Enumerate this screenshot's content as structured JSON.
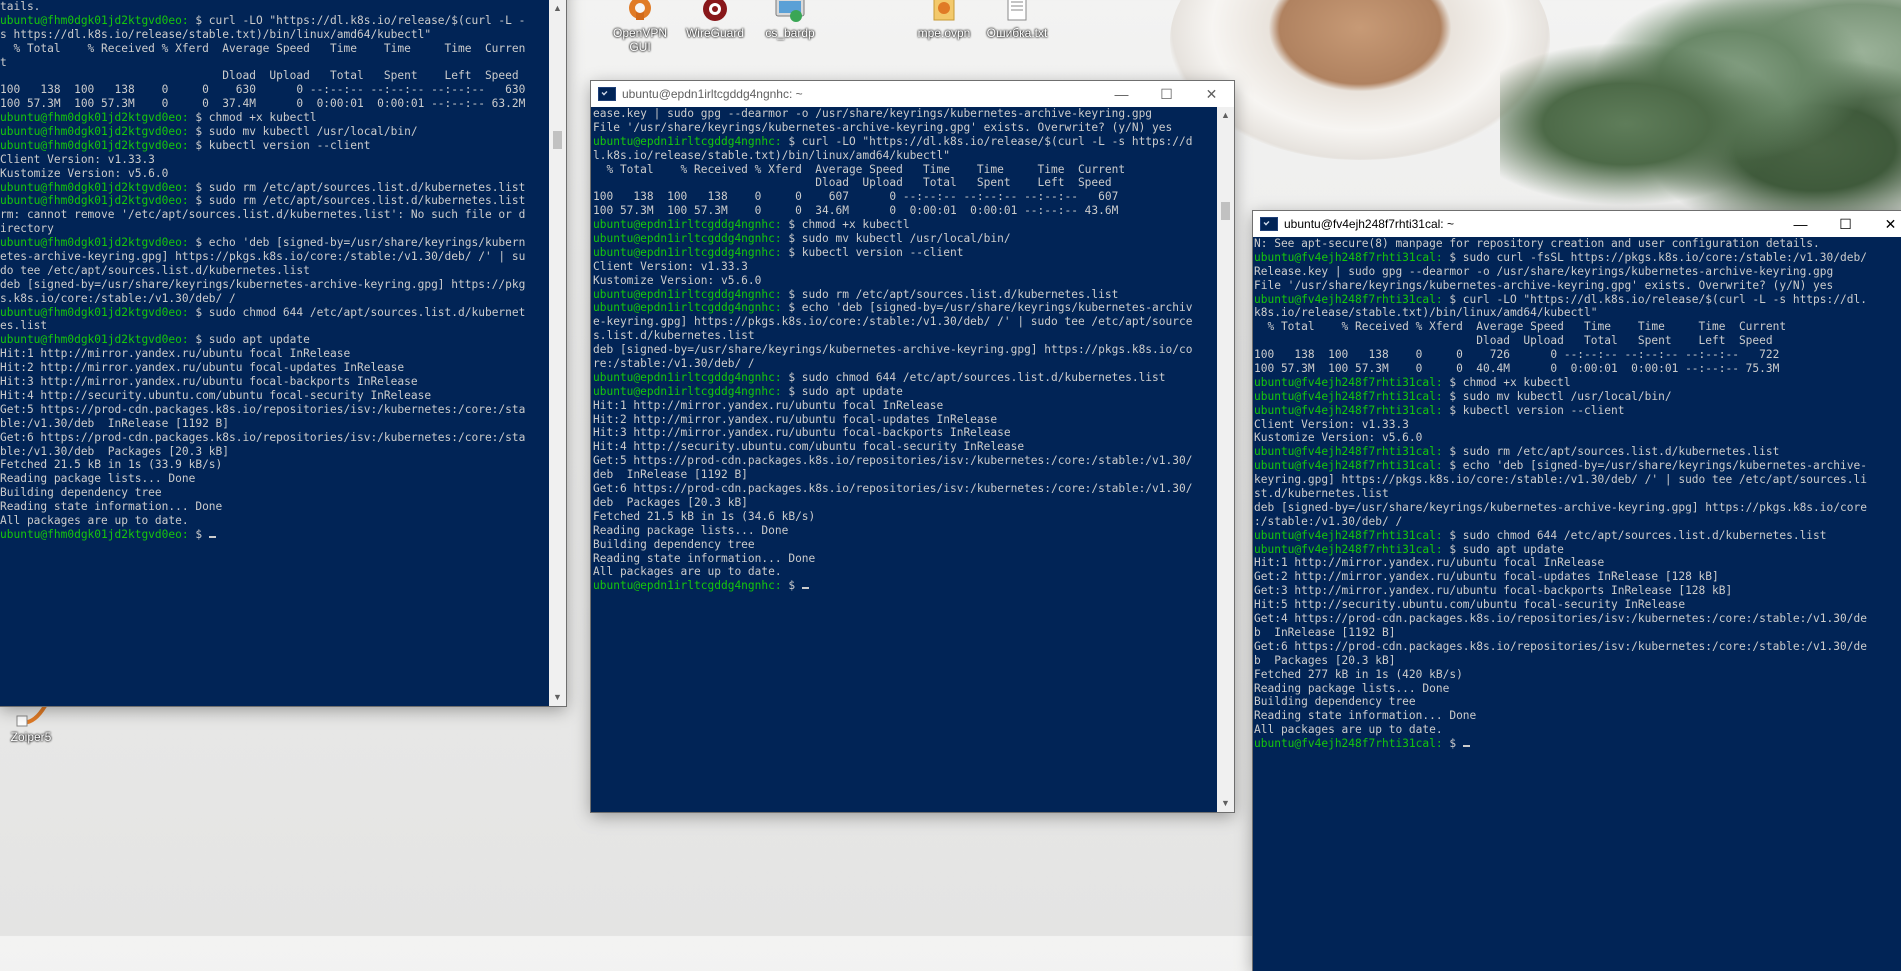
{
  "desktop": {
    "icons": [
      {
        "label": "OpenVPN GUI",
        "icon": "openvpn-icon"
      },
      {
        "label": "WireGuard",
        "icon": "wireguard-icon"
      },
      {
        "label": "cs_bardp",
        "icon": "rdp-icon"
      },
      {
        "label": "mpe.ovpn",
        "icon": "config-file-icon"
      },
      {
        "label": "Ошибка.txt",
        "icon": "text-file-icon"
      },
      {
        "label": "Zoiper5",
        "icon": "zoiper-icon"
      }
    ]
  },
  "windows": [
    {
      "id": "left",
      "title": "",
      "lines": [
        "tails.",
        [
          {
            "t": "ubuntu@fhm0dgk01jd2ktgvd0eo:",
            "c": "p"
          },
          {
            "t": " $ curl -LO \"https://dl.k8s.io/release/$(curl -L -"
          }
        ],
        "s https://dl.k8s.io/release/stable.txt)/bin/linux/amd64/kubectl\"",
        "  % Total    % Received % Xferd  Average Speed   Time    Time     Time  Curren",
        "t",
        "                                 Dload  Upload   Total   Spent    Left  Speed",
        "100   138  100   138    0     0    630      0 --:--:-- --:--:-- --:--:--   630",
        "100 57.3M  100 57.3M    0     0  37.4M      0  0:00:01  0:00:01 --:--:-- 63.2M",
        [
          {
            "t": "ubuntu@fhm0dgk01jd2ktgvd0eo:",
            "c": "p"
          },
          {
            "t": " $ chmod +x kubectl"
          }
        ],
        [
          {
            "t": "ubuntu@fhm0dgk01jd2ktgvd0eo:",
            "c": "p"
          },
          {
            "t": " $ sudo mv kubectl /usr/local/bin/"
          }
        ],
        [
          {
            "t": "ubuntu@fhm0dgk01jd2ktgvd0eo:",
            "c": "p"
          },
          {
            "t": " $ kubectl version --client"
          }
        ],
        "Client Version: v1.33.3",
        "Kustomize Version: v5.6.0",
        [
          {
            "t": "ubuntu@fhm0dgk01jd2ktgvd0eo:",
            "c": "p"
          },
          {
            "t": " $ sudo rm /etc/apt/sources.list.d/kubernetes.list"
          }
        ],
        [
          {
            "t": "ubuntu@fhm0dgk01jd2ktgvd0eo:",
            "c": "p"
          },
          {
            "t": " $ sudo rm /etc/apt/sources.list.d/kubernetes.list"
          }
        ],
        "rm: cannot remove '/etc/apt/sources.list.d/kubernetes.list': No such file or d",
        "irectory",
        [
          {
            "t": "ubuntu@fhm0dgk01jd2ktgvd0eo:",
            "c": "p"
          },
          {
            "t": " $ echo 'deb [signed-by=/usr/share/keyrings/kubern"
          }
        ],
        "etes-archive-keyring.gpg] https://pkgs.k8s.io/core:/stable:/v1.30/deb/ /' | su",
        "do tee /etc/apt/sources.list.d/kubernetes.list",
        "deb [signed-by=/usr/share/keyrings/kubernetes-archive-keyring.gpg] https://pkg",
        "s.k8s.io/core:/stable:/v1.30/deb/ /",
        [
          {
            "t": "ubuntu@fhm0dgk01jd2ktgvd0eo:",
            "c": "p"
          },
          {
            "t": " $ sudo chmod 644 /etc/apt/sources.list.d/kubernet"
          }
        ],
        "es.list",
        [
          {
            "t": "ubuntu@fhm0dgk01jd2ktgvd0eo:",
            "c": "p"
          },
          {
            "t": " $ sudo apt update"
          }
        ],
        "Hit:1 http://mirror.yandex.ru/ubuntu focal InRelease",
        "Hit:2 http://mirror.yandex.ru/ubuntu focal-updates InRelease",
        "Hit:3 http://mirror.yandex.ru/ubuntu focal-backports InRelease",
        "Hit:4 http://security.ubuntu.com/ubuntu focal-security InRelease",
        "Get:5 https://prod-cdn.packages.k8s.io/repositories/isv:/kubernetes:/core:/sta",
        "ble:/v1.30/deb  InRelease [1192 B]",
        "Get:6 https://prod-cdn.packages.k8s.io/repositories/isv:/kubernetes:/core:/sta",
        "ble:/v1.30/deb  Packages [20.3 kB]",
        "Fetched 21.5 kB in 1s (33.9 kB/s)",
        "Reading package lists... Done",
        "Building dependency tree",
        "Reading state information... Done",
        "All packages are up to date.",
        [
          {
            "t": "ubuntu@fhm0dgk01jd2ktgvd0eo:",
            "c": "p"
          },
          {
            "t": " $ "
          },
          {
            "cursor": true
          }
        ]
      ]
    },
    {
      "id": "middle",
      "title": "ubuntu@epdn1irltcgddg4ngnhc: ~",
      "lines": [
        "ease.key | sudo gpg --dearmor -o /usr/share/keyrings/kubernetes-archive-keyring.gpg",
        "File '/usr/share/keyrings/kubernetes-archive-keyring.gpg' exists. Overwrite? (y/N) yes",
        [
          {
            "t": "ubuntu@epdn1irltcgddg4ngnhc:",
            "c": "p"
          },
          {
            "t": " $ curl -LO \"https://dl.k8s.io/release/$(curl -L -s https://d"
          }
        ],
        "l.k8s.io/release/stable.txt)/bin/linux/amd64/kubectl\"",
        "  % Total    % Received % Xferd  Average Speed   Time    Time     Time  Current",
        "                                 Dload  Upload   Total   Spent    Left  Speed",
        "100   138  100   138    0     0    607      0 --:--:-- --:--:-- --:--:--   607",
        "100 57.3M  100 57.3M    0     0  34.6M      0  0:00:01  0:00:01 --:--:-- 43.6M",
        [
          {
            "t": "ubuntu@epdn1irltcgddg4ngnhc:",
            "c": "p"
          },
          {
            "t": " $ chmod +x kubectl"
          }
        ],
        [
          {
            "t": "ubuntu@epdn1irltcgddg4ngnhc:",
            "c": "p"
          },
          {
            "t": " $ sudo mv kubectl /usr/local/bin/"
          }
        ],
        [
          {
            "t": "ubuntu@epdn1irltcgddg4ngnhc:",
            "c": "p"
          },
          {
            "t": " $ kubectl version --client"
          }
        ],
        "Client Version: v1.33.3",
        "Kustomize Version: v5.6.0",
        [
          {
            "t": "ubuntu@epdn1irltcgddg4ngnhc:",
            "c": "p"
          },
          {
            "t": " $ sudo rm /etc/apt/sources.list.d/kubernetes.list"
          }
        ],
        [
          {
            "t": "ubuntu@epdn1irltcgddg4ngnhc:",
            "c": "p"
          },
          {
            "t": " $ echo 'deb [signed-by=/usr/share/keyrings/kubernetes-archiv"
          }
        ],
        "e-keyring.gpg] https://pkgs.k8s.io/core:/stable:/v1.30/deb/ /' | sudo tee /etc/apt/source",
        "s.list.d/kubernetes.list",
        "deb [signed-by=/usr/share/keyrings/kubernetes-archive-keyring.gpg] https://pkgs.k8s.io/co",
        "re:/stable:/v1.30/deb/ /",
        [
          {
            "t": "ubuntu@epdn1irltcgddg4ngnhc:",
            "c": "p"
          },
          {
            "t": " $ sudo chmod 644 /etc/apt/sources.list.d/kubernetes.list"
          }
        ],
        [
          {
            "t": "ubuntu@epdn1irltcgddg4ngnhc:",
            "c": "p"
          },
          {
            "t": " $ sudo apt update"
          }
        ],
        "Hit:1 http://mirror.yandex.ru/ubuntu focal InRelease",
        "Hit:2 http://mirror.yandex.ru/ubuntu focal-updates InRelease",
        "Hit:3 http://mirror.yandex.ru/ubuntu focal-backports InRelease",
        "Hit:4 http://security.ubuntu.com/ubuntu focal-security InRelease",
        "Get:5 https://prod-cdn.packages.k8s.io/repositories/isv:/kubernetes:/core:/stable:/v1.30/",
        "deb  InRelease [1192 B]",
        "Get:6 https://prod-cdn.packages.k8s.io/repositories/isv:/kubernetes:/core:/stable:/v1.30/",
        "deb  Packages [20.3 kB]",
        "Fetched 21.5 kB in 1s (34.6 kB/s)",
        "Reading package lists... Done",
        "Building dependency tree",
        "Reading state information... Done",
        "All packages are up to date.",
        [
          {
            "t": "ubuntu@epdn1irltcgddg4ngnhc:",
            "c": "p"
          },
          {
            "t": " $ "
          },
          {
            "cursor": true
          }
        ]
      ]
    },
    {
      "id": "right",
      "title": "ubuntu@fv4ejh248f7rhti31cal: ~",
      "lines": [
        "N: See apt-secure(8) manpage for repository creation and user configuration details.",
        [
          {
            "t": "ubuntu@fv4ejh248f7rhti31cal:",
            "c": "p"
          },
          {
            "t": " $ sudo curl -fsSL https://pkgs.k8s.io/core:/stable:/v1.30/deb/"
          }
        ],
        "Release.key | sudo gpg --dearmor -o /usr/share/keyrings/kubernetes-archive-keyring.gpg",
        "File '/usr/share/keyrings/kubernetes-archive-keyring.gpg' exists. Overwrite? (y/N) yes",
        [
          {
            "t": "ubuntu@fv4ejh248f7rhti31cal:",
            "c": "p"
          },
          {
            "t": " $ curl -LO \"https://dl.k8s.io/release/$(curl -L -s https://dl."
          }
        ],
        "k8s.io/release/stable.txt)/bin/linux/amd64/kubectl\"",
        "  % Total    % Received % Xferd  Average Speed   Time    Time     Time  Current",
        "                                 Dload  Upload   Total   Spent    Left  Speed",
        "100   138  100   138    0     0    726      0 --:--:-- --:--:-- --:--:--   722",
        "100 57.3M  100 57.3M    0     0  40.4M      0  0:00:01  0:00:01 --:--:-- 75.3M",
        [
          {
            "t": "ubuntu@fv4ejh248f7rhti31cal:",
            "c": "p"
          },
          {
            "t": " $ chmod +x kubectl"
          }
        ],
        [
          {
            "t": "ubuntu@fv4ejh248f7rhti31cal:",
            "c": "p"
          },
          {
            "t": " $ sudo mv kubectl /usr/local/bin/"
          }
        ],
        [
          {
            "t": "ubuntu@fv4ejh248f7rhti31cal:",
            "c": "p"
          },
          {
            "t": " $ kubectl version --client"
          }
        ],
        "Client Version: v1.33.3",
        "Kustomize Version: v5.6.0",
        [
          {
            "t": "ubuntu@fv4ejh248f7rhti31cal:",
            "c": "p"
          },
          {
            "t": " $ sudo rm /etc/apt/sources.list.d/kubernetes.list"
          }
        ],
        [
          {
            "t": "ubuntu@fv4ejh248f7rhti31cal:",
            "c": "p"
          },
          {
            "t": " $ echo 'deb [signed-by=/usr/share/keyrings/kubernetes-archive-"
          }
        ],
        "keyring.gpg] https://pkgs.k8s.io/core:/stable:/v1.30/deb/ /' | sudo tee /etc/apt/sources.li",
        "st.d/kubernetes.list",
        "deb [signed-by=/usr/share/keyrings/kubernetes-archive-keyring.gpg] https://pkgs.k8s.io/core",
        ":/stable:/v1.30/deb/ /",
        [
          {
            "t": "ubuntu@fv4ejh248f7rhti31cal:",
            "c": "p"
          },
          {
            "t": " $ sudo chmod 644 /etc/apt/sources.list.d/kubernetes.list"
          }
        ],
        [
          {
            "t": "ubuntu@fv4ejh248f7rhti31cal:",
            "c": "p"
          },
          {
            "t": " $ sudo apt update"
          }
        ],
        "Hit:1 http://mirror.yandex.ru/ubuntu focal InRelease",
        "Get:2 http://mirror.yandex.ru/ubuntu focal-updates InRelease [128 kB]",
        "Get:3 http://mirror.yandex.ru/ubuntu focal-backports InRelease [128 kB]",
        "Hit:5 http://security.ubuntu.com/ubuntu focal-security InRelease",
        "Get:4 https://prod-cdn.packages.k8s.io/repositories/isv:/kubernetes:/core:/stable:/v1.30/de",
        "b  InRelease [1192 B]",
        "Get:6 https://prod-cdn.packages.k8s.io/repositories/isv:/kubernetes:/core:/stable:/v1.30/de",
        "b  Packages [20.3 kB]",
        "Fetched 277 kB in 1s (420 kB/s)",
        "Reading package lists... Done",
        "Building dependency tree",
        "Reading state information... Done",
        "All packages are up to date.",
        [
          {
            "t": "ubuntu@fv4ejh248f7rhti31cal:",
            "c": "p"
          },
          {
            "t": " $ "
          },
          {
            "cursor": true
          }
        ]
      ]
    }
  ],
  "window_controls": {
    "minimize": "—",
    "maximize": "☐",
    "close": "✕"
  },
  "colors": {
    "terminal_bg": "#012456",
    "prompt": "#16c60c",
    "text": "#cccccc"
  }
}
